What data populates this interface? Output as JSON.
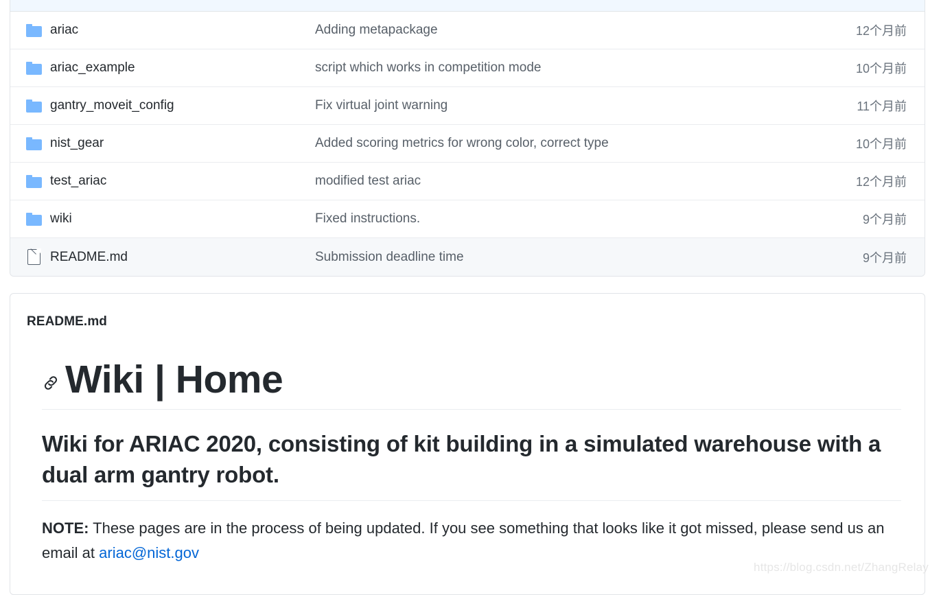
{
  "file_list": {
    "rows": [
      {
        "icon": "folder-icon",
        "name": "ariac",
        "message": "Adding metapackage",
        "time": "12个月前",
        "shaded": false
      },
      {
        "icon": "folder-icon",
        "name": "ariac_example",
        "message": "script which works in competition mode",
        "time": "10个月前",
        "shaded": false
      },
      {
        "icon": "folder-icon",
        "name": "gantry_moveit_config",
        "message": "Fix virtual joint warning",
        "time": "11个月前",
        "shaded": false
      },
      {
        "icon": "folder-icon",
        "name": "nist_gear",
        "message": "Added scoring metrics for wrong color, correct type",
        "time": "10个月前",
        "shaded": false
      },
      {
        "icon": "folder-icon",
        "name": "test_ariac",
        "message": "modified test ariac",
        "time": "12个月前",
        "shaded": false
      },
      {
        "icon": "folder-icon",
        "name": "wiki",
        "message": "Fixed instructions.",
        "time": "9个月前",
        "shaded": false
      },
      {
        "icon": "file-icon",
        "name": "README.md",
        "message": "Submission deadline time",
        "time": "9个月前",
        "shaded": true
      }
    ]
  },
  "readme": {
    "file_title": "README.md",
    "anchor_icon": "link-icon",
    "heading1": "Wiki | Home",
    "heading2": "Wiki for ARIAC 2020, consisting of kit building in a simulated warehouse with a dual arm gantry robot.",
    "note_label": "NOTE:",
    "note_text": " These pages are in the process of being updated. If you see something that looks like it got missed, please send us an email at ",
    "email": "ariac@nist.gov"
  },
  "watermark": {
    "text": "https://blog.csdn.net/ZhangRelay"
  },
  "colors": {
    "folder": "#79b8ff",
    "link": "#0366d6",
    "header_bg": "#f1f8ff",
    "row_shaded_bg": "#f6f8fa",
    "border": "#e1e4e8"
  }
}
